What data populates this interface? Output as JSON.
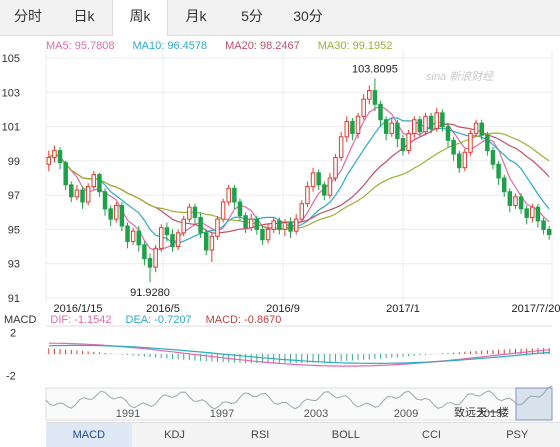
{
  "tabs": {
    "items": [
      {
        "label": "分时"
      },
      {
        "label": "日k"
      },
      {
        "label": "周k"
      },
      {
        "label": "月k"
      },
      {
        "label": "5分"
      },
      {
        "label": "30分"
      }
    ],
    "active_index": 2
  },
  "ma_legend": [
    {
      "text": "MA5: 95.7808",
      "color": "#e06aa9"
    },
    {
      "text": "MA10: 96.4578",
      "color": "#2eaac6"
    },
    {
      "text": "MA20: 98.2467",
      "color": "#c0506a"
    },
    {
      "text": "MA30: 99.1952",
      "color": "#a2ad35"
    }
  ],
  "watermark": "sina 新浪财经",
  "macd_legend": {
    "title": "MACD",
    "dif": "DIF: -1.1542",
    "dea": "DEA: -0.7207",
    "macd": "MACD: -0.8670"
  },
  "brand": "致远天一楼",
  "bottom_tabs": [
    {
      "label": "MACD"
    },
    {
      "label": "KDJ"
    },
    {
      "label": "RSI"
    },
    {
      "label": "BOLL"
    },
    {
      "label": "CCI"
    },
    {
      "label": "PSY"
    }
  ],
  "bottom_active": 0,
  "colors": {
    "up": "#e03c31",
    "down": "#1fa04a",
    "ma5": "#e06aa9",
    "ma10": "#2eaac6",
    "ma20": "#c0506a",
    "ma30": "#a2ad35",
    "dif": "#e06aa9",
    "dea": "#2eaac6",
    "macd_pos": "#c2413a",
    "macd_neg": "#3fa58f"
  },
  "chart_data": {
    "type": "candlestick",
    "y_ticks": [
      "105",
      "103",
      "101",
      "99",
      "97",
      "95",
      "93",
      "91"
    ],
    "y_range": [
      91,
      105
    ],
    "x_tick_labels": [
      "2016/1/15",
      "2016/5",
      "2016/9",
      "2017/1",
      "2017/7/20"
    ],
    "annotations": {
      "high": "103.8095",
      "low": "91.9280"
    },
    "overview_labels": [
      "1991",
      "1997",
      "2003",
      "2009",
      "2015"
    ],
    "macd_ticks": [
      "2",
      "-2"
    ],
    "candles": [
      [
        98.8,
        99.2,
        98.4,
        99.6
      ],
      [
        99.2,
        99.6,
        98.9,
        99.9
      ],
      [
        99.6,
        98.9,
        98.5,
        99.8
      ],
      [
        98.9,
        97.6,
        97.3,
        99.0
      ],
      [
        97.6,
        96.9,
        96.6,
        97.8
      ],
      [
        96.9,
        97.3,
        96.7,
        97.6
      ],
      [
        97.3,
        96.6,
        96.2,
        97.5
      ],
      [
        96.6,
        97.5,
        96.4,
        97.7
      ],
      [
        97.5,
        98.2,
        97.3,
        98.4
      ],
      [
        98.2,
        97.2,
        96.9,
        98.3
      ],
      [
        97.2,
        96.2,
        95.8,
        97.4
      ],
      [
        96.2,
        95.6,
        95.2,
        96.4
      ],
      [
        95.6,
        96.4,
        95.4,
        96.6
      ],
      [
        96.4,
        95.2,
        94.9,
        96.6
      ],
      [
        95.2,
        94.3,
        93.9,
        95.4
      ],
      [
        94.3,
        94.9,
        94.1,
        95.1
      ],
      [
        94.9,
        94.1,
        93.7,
        95.2
      ],
      [
        94.1,
        93.3,
        92.9,
        94.3
      ],
      [
        93.3,
        92.8,
        91.93,
        93.6
      ],
      [
        92.8,
        93.9,
        92.5,
        94.1
      ],
      [
        93.9,
        95.1,
        93.7,
        95.3
      ],
      [
        95.1,
        94.7,
        94.3,
        95.4
      ],
      [
        94.7,
        94.0,
        93.7,
        95.0
      ],
      [
        94.0,
        94.8,
        93.8,
        95.0
      ],
      [
        94.8,
        95.6,
        94.6,
        95.8
      ],
      [
        95.6,
        96.3,
        95.4,
        96.5
      ],
      [
        96.3,
        95.7,
        95.3,
        96.5
      ],
      [
        95.7,
        94.8,
        94.5,
        96.0
      ],
      [
        94.8,
        93.8,
        93.5,
        95.0
      ],
      [
        93.8,
        94.6,
        93.1,
        94.8
      ],
      [
        94.6,
        95.6,
        94.4,
        95.8
      ],
      [
        95.6,
        96.6,
        95.4,
        96.8
      ],
      [
        96.6,
        97.4,
        96.4,
        97.6
      ],
      [
        97.4,
        96.6,
        96.2,
        97.6
      ],
      [
        96.6,
        95.8,
        95.5,
        96.8
      ],
      [
        95.8,
        95.1,
        94.8,
        96.0
      ],
      [
        95.1,
        95.6,
        94.9,
        95.9
      ],
      [
        95.6,
        95.0,
        94.7,
        95.8
      ],
      [
        95.0,
        94.4,
        94.1,
        95.2
      ],
      [
        94.4,
        95.0,
        94.2,
        95.3
      ],
      [
        95.0,
        95.5,
        94.8,
        95.7
      ],
      [
        95.5,
        95.0,
        94.7,
        95.7
      ],
      [
        95.0,
        95.4,
        94.6,
        95.6
      ],
      [
        95.4,
        94.9,
        94.5,
        95.7
      ],
      [
        94.9,
        95.6,
        94.7,
        95.9
      ],
      [
        95.6,
        96.5,
        95.4,
        96.7
      ],
      [
        96.5,
        97.5,
        96.3,
        97.8
      ],
      [
        97.5,
        98.3,
        97.2,
        98.6
      ],
      [
        98.3,
        97.6,
        97.3,
        98.5
      ],
      [
        97.6,
        97.0,
        96.7,
        97.8
      ],
      [
        97.0,
        98.0,
        96.8,
        98.3
      ],
      [
        98.0,
        99.2,
        97.8,
        99.4
      ],
      [
        99.2,
        100.4,
        99.0,
        100.7
      ],
      [
        100.4,
        101.3,
        100.1,
        101.6
      ],
      [
        101.3,
        100.6,
        100.2,
        101.5
      ],
      [
        100.6,
        101.6,
        100.3,
        101.8
      ],
      [
        101.6,
        102.6,
        101.4,
        102.9
      ],
      [
        102.6,
        103.1,
        102.3,
        103.4
      ],
      [
        103.1,
        102.3,
        101.9,
        103.81
      ],
      [
        102.3,
        101.4,
        101.0,
        102.5
      ],
      [
        101.4,
        100.6,
        100.2,
        101.6
      ],
      [
        100.6,
        101.2,
        100.4,
        101.5
      ],
      [
        101.2,
        100.3,
        99.8,
        101.4
      ],
      [
        100.3,
        99.6,
        99.3,
        100.5
      ],
      [
        99.6,
        100.6,
        99.4,
        100.8
      ],
      [
        100.6,
        101.4,
        100.3,
        101.6
      ],
      [
        101.4,
        100.7,
        100.4,
        101.6
      ],
      [
        100.7,
        101.6,
        100.5,
        101.8
      ],
      [
        101.6,
        100.9,
        100.6,
        101.8
      ],
      [
        100.9,
        101.8,
        100.7,
        102.1
      ],
      [
        101.8,
        101.0,
        100.7,
        102.0
      ],
      [
        101.0,
        100.2,
        99.8,
        101.2
      ],
      [
        100.2,
        99.4,
        99.0,
        100.4
      ],
      [
        99.4,
        98.6,
        98.3,
        99.6
      ],
      [
        98.6,
        99.5,
        98.4,
        99.7
      ],
      [
        99.5,
        100.6,
        99.3,
        100.8
      ],
      [
        100.6,
        101.2,
        100.4,
        101.4
      ],
      [
        101.2,
        100.5,
        100.2,
        101.4
      ],
      [
        100.5,
        99.6,
        99.3,
        100.7
      ],
      [
        99.6,
        98.8,
        98.5,
        99.8
      ],
      [
        98.8,
        98.0,
        97.6,
        99.0
      ],
      [
        98.0,
        97.2,
        96.9,
        98.2
      ],
      [
        97.2,
        96.4,
        96.0,
        97.4
      ],
      [
        96.4,
        96.9,
        96.2,
        97.1
      ],
      [
        96.9,
        96.2,
        95.9,
        97.1
      ],
      [
        96.2,
        95.7,
        95.3,
        96.4
      ],
      [
        95.7,
        96.3,
        95.4,
        96.5
      ],
      [
        96.3,
        95.5,
        95.1,
        96.5
      ],
      [
        95.5,
        95.0,
        94.7,
        95.7
      ],
      [
        95.0,
        94.7,
        94.4,
        95.2
      ]
    ],
    "macd": [
      {
        "dif": 1.0,
        "dea": 0.6,
        "hist": 0.9
      },
      {
        "dif": 0.8,
        "dea": 0.7,
        "hist": 0.3
      },
      {
        "dif": -1.2,
        "dea": -0.7,
        "hist": -0.9
      }
    ]
  }
}
